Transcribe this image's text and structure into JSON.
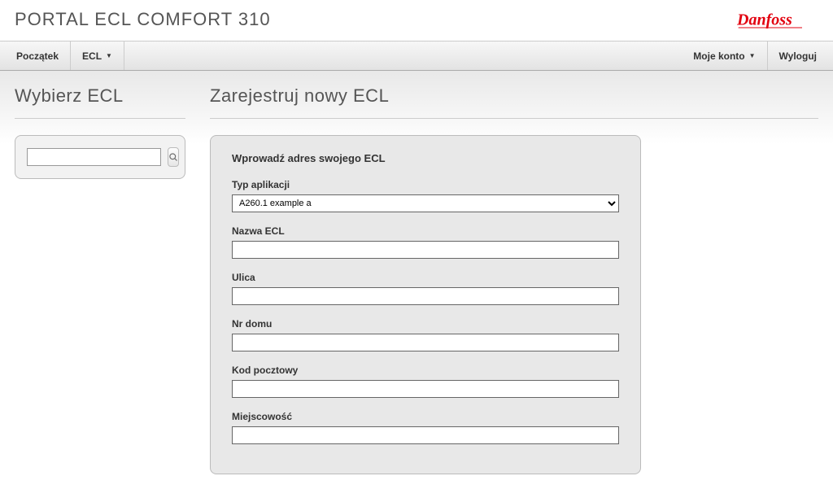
{
  "header": {
    "title": "PORTAL ECL COMFORT 310",
    "logo_text": "Danfoss"
  },
  "nav": {
    "left": [
      {
        "label": "Początek",
        "dropdown": false
      },
      {
        "label": "ECL",
        "dropdown": true
      }
    ],
    "right": [
      {
        "label": "Moje konto",
        "dropdown": true
      },
      {
        "label": "Wyloguj",
        "dropdown": false
      }
    ]
  },
  "sidebar": {
    "heading": "Wybierz ECL",
    "search": {
      "value": "",
      "placeholder": ""
    }
  },
  "main": {
    "heading": "Zarejestruj nowy ECL",
    "form": {
      "title": "Wprowadź adres swojego ECL",
      "fields": {
        "app_type": {
          "label": "Typ aplikacji",
          "value": "A260.1 example a"
        },
        "ecl_name": {
          "label": "Nazwa ECL",
          "value": ""
        },
        "street": {
          "label": "Ulica",
          "value": ""
        },
        "house_no": {
          "label": "Nr domu",
          "value": ""
        },
        "postal": {
          "label": "Kod pocztowy",
          "value": ""
        },
        "city": {
          "label": "Miejscowość",
          "value": ""
        }
      }
    }
  }
}
